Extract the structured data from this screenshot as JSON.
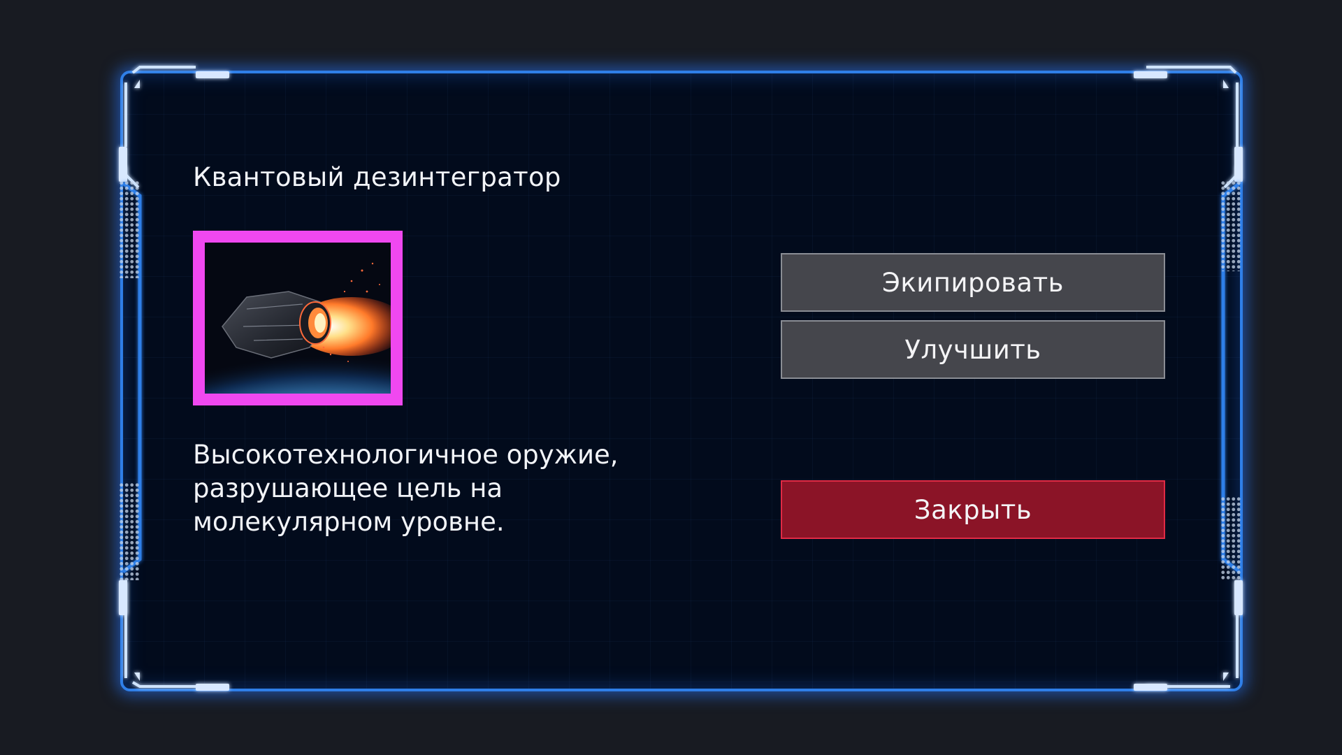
{
  "item": {
    "title": "Квантовый дезинтегратор",
    "image_icon": "spaceship-weapon-image",
    "description": "Высокотехнологичное оружие,\nразрушающее цель на\nмолекулярном уровне.",
    "rarity_frame_color": "#f048f0"
  },
  "actions": {
    "equip_label": "Экипировать",
    "upgrade_label": "Улучшить",
    "close_label": "Закрыть"
  },
  "colors": {
    "background": "#181b22",
    "panel_fill": "#020b1c",
    "panel_border": "#2f7fe8",
    "button_gray": "#45464c",
    "button_close": "#8b1427",
    "text": "#f2f4f8"
  }
}
